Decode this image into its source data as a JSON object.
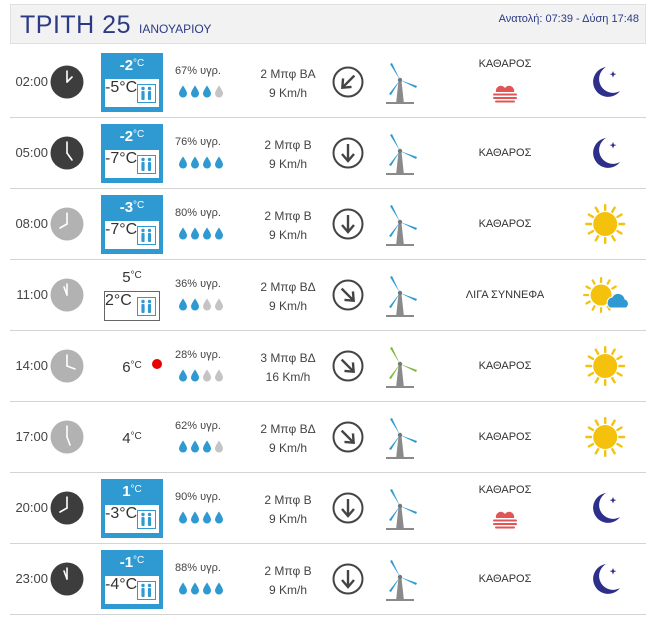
{
  "header": {
    "day": "ΤΡΙΤΗ 25",
    "month": "ΙΑΝΟΥΑΡΙΟΥ",
    "sun": "Ανατολή: 07:39 - Δύση 17:48"
  },
  "colors": {
    "accent": "#2f9ad2",
    "title": "#2b3a86",
    "warning": "#e60000"
  },
  "rows": [
    {
      "time": "02:00",
      "clock": "dark",
      "highlight": true,
      "temp": "-2",
      "feels": "-5°C",
      "hum": "67% υγρ.",
      "drops": 3,
      "wind": "2 Μπφ ΒΑ",
      "speed": "9 Km/h",
      "arrow": "north-east",
      "turbine": "blue",
      "cond": "ΚΑΘΑΡΟΣ",
      "fog": true,
      "sky": "moon"
    },
    {
      "time": "05:00",
      "clock": "dark",
      "highlight": true,
      "temp": "-2",
      "feels": "-7°C",
      "hum": "76% υγρ.",
      "drops": 4,
      "wind": "2 Μπφ Β",
      "speed": "9 Km/h",
      "arrow": "north",
      "turbine": "blue",
      "cond": "ΚΑΘΑΡΟΣ",
      "fog": false,
      "sky": "moon"
    },
    {
      "time": "08:00",
      "clock": "light",
      "highlight": true,
      "temp": "-3",
      "feels": "-7°C",
      "hum": "80% υγρ.",
      "drops": 4,
      "wind": "2 Μπφ Β",
      "speed": "9 Km/h",
      "arrow": "north",
      "turbine": "blue",
      "cond": "ΚΑΘΑΡΟΣ",
      "fog": false,
      "sky": "sun"
    },
    {
      "time": "11:00",
      "clock": "light",
      "highlight": false,
      "temp": "5",
      "feels": "2°C",
      "hum": "36% υγρ.",
      "drops": 2,
      "wind": "2 Μπφ ΒΔ",
      "speed": "9 Km/h",
      "arrow": "north-west",
      "turbine": "blue",
      "cond": "ΛΙΓΑ ΣΥΝΝΕΦΑ",
      "fog": false,
      "sky": "sun-cloud"
    },
    {
      "time": "14:00",
      "clock": "light",
      "highlight": false,
      "temp": "6",
      "feels": null,
      "warning": true,
      "hum": "28% υγρ.",
      "drops": 2,
      "wind": "3 Μπφ ΒΔ",
      "speed": "16 Km/h",
      "arrow": "north-west",
      "turbine": "green",
      "cond": "ΚΑΘΑΡΟΣ",
      "fog": false,
      "sky": "sun"
    },
    {
      "time": "17:00",
      "clock": "light",
      "highlight": false,
      "temp": "4",
      "feels": null,
      "hum": "62% υγρ.",
      "drops": 3,
      "wind": "2 Μπφ ΒΔ",
      "speed": "9 Km/h",
      "arrow": "north-west",
      "turbine": "blue",
      "cond": "ΚΑΘΑΡΟΣ",
      "fog": false,
      "sky": "sun"
    },
    {
      "time": "20:00",
      "clock": "dark",
      "highlight": true,
      "temp": "1",
      "feels": "-3°C",
      "hum": "90% υγρ.",
      "drops": 4,
      "wind": "2 Μπφ Β",
      "speed": "9 Km/h",
      "arrow": "north",
      "turbine": "blue",
      "cond": "ΚΑΘΑΡΟΣ",
      "fog": true,
      "sky": "moon"
    },
    {
      "time": "23:00",
      "clock": "dark",
      "highlight": true,
      "temp": "-1",
      "feels": "-4°C",
      "hum": "88% υγρ.",
      "drops": 4,
      "wind": "2 Μπφ Β",
      "speed": "9 Km/h",
      "arrow": "north",
      "turbine": "blue",
      "cond": "ΚΑΘΑΡΟΣ",
      "fog": false,
      "sky": "moon"
    }
  ]
}
